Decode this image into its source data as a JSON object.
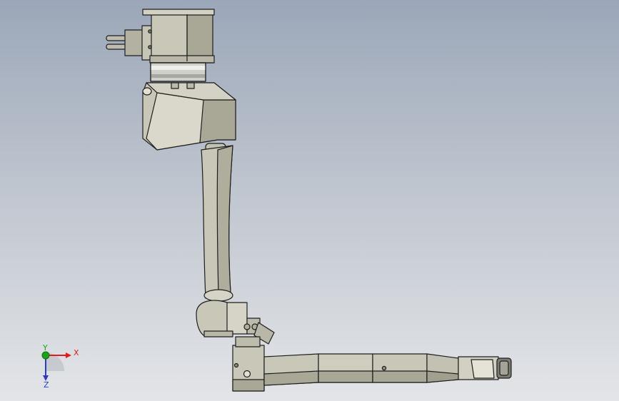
{
  "viewport": {
    "background_top": "#9ba7b9",
    "background_bottom": "#e3e5e8"
  },
  "model": {
    "type": "robot-arm-cad-model",
    "body_color": "#c9c7b8",
    "shade_color": "#a9a796",
    "dark_color": "#8f8d7e",
    "edge_color": "#1e1e1e"
  },
  "triad": {
    "x_label": "X",
    "y_label": "Y",
    "z_label": "Z",
    "x_color": "#e01c1c",
    "y_color": "#1aa31a",
    "z_color": "#2b3cc4"
  }
}
